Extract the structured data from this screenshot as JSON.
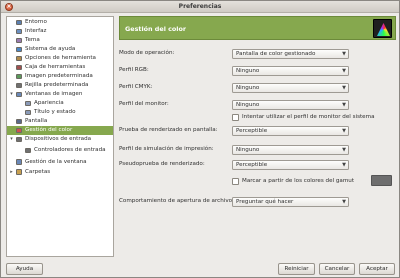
{
  "window": {
    "title": "Preferencias",
    "close_glyph": "×"
  },
  "tree": {
    "items": [
      {
        "label": "Entorno",
        "icon": "monitor-icon",
        "color": "#5b7fb0"
      },
      {
        "label": "Interfaz",
        "icon": "interface-icon",
        "color": "#6b8fc0"
      },
      {
        "label": "Tema",
        "icon": "theme-icon",
        "color": "#9a7bb0"
      },
      {
        "label": "Sistema de ayuda",
        "icon": "help-icon",
        "color": "#4b86c4"
      },
      {
        "label": "Opciones de herramienta",
        "icon": "tool-options-icon",
        "color": "#b08a4b"
      },
      {
        "label": "Caja de herramientas",
        "icon": "toolbox-icon",
        "color": "#a05050"
      },
      {
        "label": "Imagen predeterminada",
        "icon": "image-icon",
        "color": "#5b9a5b"
      },
      {
        "label": "Rejilla predeterminada",
        "icon": "grid-icon",
        "color": "#707070"
      },
      {
        "label": "Ventanas de imagen",
        "icon": "image-windows-icon",
        "color": "#6a88b8"
      },
      {
        "label": "Apariencia",
        "icon": "appearance-icon",
        "color": "#8a9ab8"
      },
      {
        "label": "Título y estado",
        "icon": "title-status-icon",
        "color": "#8a9ab8"
      },
      {
        "label": "Pantalla",
        "icon": "display-icon",
        "color": "#5a6a8a"
      },
      {
        "label": "Gestión del color",
        "icon": "color-management-icon",
        "color": "#d05050"
      },
      {
        "label": "Dispositivos de entrada",
        "icon": "input-devices-icon",
        "color": "#707070"
      },
      {
        "label": "Controladores de entrada",
        "icon": "input-controllers-icon",
        "color": "#707070"
      },
      {
        "label": "Gestión de la ventana",
        "icon": "window-management-icon",
        "color": "#6a88b8"
      },
      {
        "label": "Carpetas",
        "icon": "folders-icon",
        "color": "#c8a050"
      }
    ],
    "expander_closed": "▸",
    "expander_open": "▾"
  },
  "panel": {
    "title": "Gestión del color",
    "icon": "color-triangle-icon",
    "accent": "#86a84e",
    "rows": [
      {
        "label": "Modo de operación:",
        "value": "Pantalla de color gestionado"
      },
      {
        "label": "Perfil RGB:",
        "value": "Ninguno"
      },
      {
        "label": "Perfil CMYK:",
        "value": "Ninguno"
      },
      {
        "label": "Perfil del monitor:",
        "value": "Ninguno"
      },
      {
        "label": "Prueba de renderizado en pantalla:",
        "value": "Perceptible"
      },
      {
        "label": "Perfil de simulación de impresión:",
        "value": "Ninguno"
      },
      {
        "label": "Pseudoprueba de renderizado:",
        "value": "Perceptible"
      },
      {
        "label": "Comportamiento de apertura de archivos:",
        "value": "Preguntar qué hacer"
      }
    ],
    "monitor_profile_check": "Intentar utilizar el perfil de monitor del sistema",
    "gamut_check": "Marcar a partir de los colores del gamut",
    "gamut_color": "#6e6e6e",
    "combo_arrow": "▼"
  },
  "buttons": {
    "help": "Ayuda",
    "reset": "Reiniciar",
    "cancel": "Cancelar",
    "accept": "Aceptar"
  }
}
